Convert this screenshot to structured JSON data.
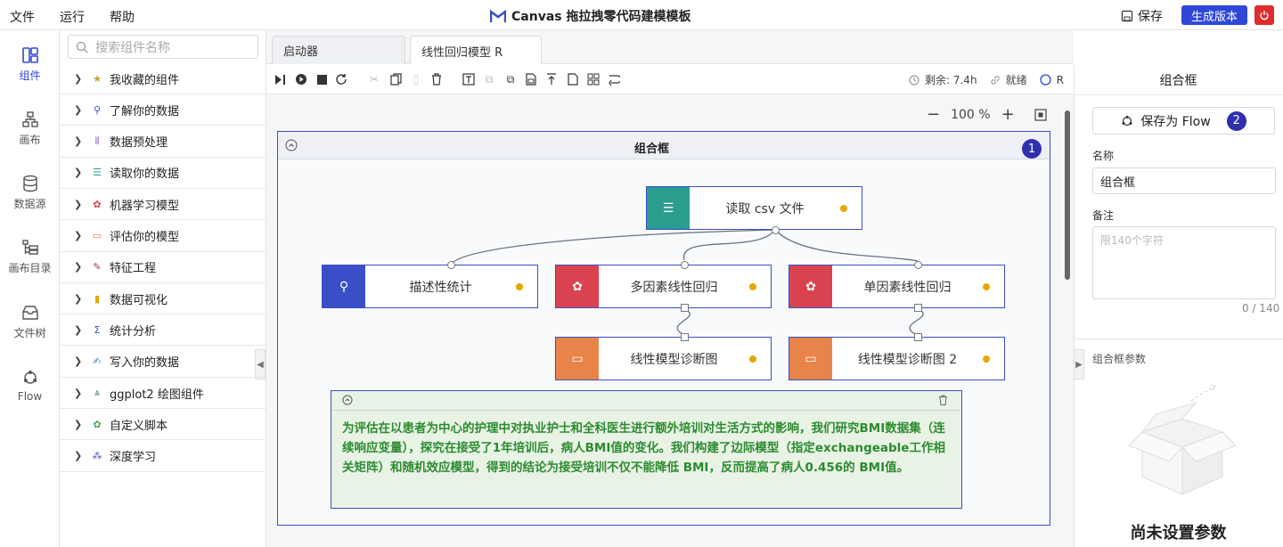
{
  "menu": {
    "file": "文件",
    "run": "运行",
    "help": "帮助"
  },
  "app": {
    "title": "Canvas 拖拉拽零代码建模模板",
    "save": "保存",
    "generate": "生成版本"
  },
  "rail": [
    {
      "label": "组件",
      "icon": "components-icon"
    },
    {
      "label": "画布",
      "icon": "canvas-icon"
    },
    {
      "label": "数据源",
      "icon": "database-icon"
    },
    {
      "label": "画布目录",
      "icon": "catalog-icon"
    },
    {
      "label": "文件树",
      "icon": "file-tree-icon"
    },
    {
      "label": "Flow",
      "icon": "flow-icon"
    }
  ],
  "search": {
    "placeholder": "搜索组件名称"
  },
  "categories": [
    {
      "label": "我收藏的组件",
      "icon": "star-icon",
      "color": "#c9a227"
    },
    {
      "label": "了解你的数据",
      "icon": "magnifier-icon",
      "color": "#3a4fc7"
    },
    {
      "label": "数据预处理",
      "icon": "preprocess-icon",
      "color": "#8a5cd6"
    },
    {
      "label": "读取你的数据",
      "icon": "read-data-icon",
      "color": "#2a9d8f"
    },
    {
      "label": "机器学习模型",
      "icon": "brain-icon",
      "color": "#d9434f"
    },
    {
      "label": "评估你的模型",
      "icon": "evaluate-icon",
      "color": "#e8834a"
    },
    {
      "label": "特征工程",
      "icon": "feature-icon",
      "color": "#b0344a"
    },
    {
      "label": "数据可视化",
      "icon": "bar-chart-icon",
      "color": "#e5a800"
    },
    {
      "label": "统计分析",
      "icon": "sigma-icon",
      "color": "#3a4fc7"
    },
    {
      "label": "写入你的数据",
      "icon": "write-data-icon",
      "color": "#3a7fc7"
    },
    {
      "label": "ggplot2 绘图组件",
      "icon": "ggplot-icon",
      "color": "#3a8f5a"
    },
    {
      "label": "自定义脚本",
      "icon": "script-icon",
      "color": "#4aa05a"
    },
    {
      "label": "深度学习",
      "icon": "deep-learning-icon",
      "color": "#3a4fc7"
    }
  ],
  "tabs": [
    {
      "label": "启动器"
    },
    {
      "label": "线性回归模型 R"
    }
  ],
  "status": {
    "remaining": "剩余: 7.4h",
    "ready": "就绪",
    "kernel": "R"
  },
  "zoom": {
    "level": "100 %",
    "minus": "−",
    "plus": "+"
  },
  "group": {
    "title": "组合框",
    "badge": "1"
  },
  "nodes": {
    "read_csv": "读取 csv 文件",
    "describe": "描述性统计",
    "multi_reg": "多因素线性回归",
    "single_reg": "单因素线性回归",
    "diag1": "线性模型诊断图",
    "diag2": "线性模型诊断图 2"
  },
  "note": {
    "text": "为评估在以患者为中心的护理中对执业护士和全科医生进行额外培训对生活方式的影响，我们研究BMI数据集（连续响应变量），探究在接受了1年培训后，病人BMI值的变化。我们构建了边际模型（指定exchangeable工作相关矩阵）和随机效应模型，得到的结论为接受培训不仅不能降低 BMI，反而提高了病人0.456的 BMI值。"
  },
  "right": {
    "title": "组合框",
    "save_flow": "保存为 Flow",
    "badge": "2",
    "name_label": "名称",
    "name_value": "组合框",
    "note_label": "备注",
    "note_placeholder": "限140个字符",
    "counter": "0 / 140",
    "params_label": "组合框参数",
    "empty": "尚未设置参数"
  }
}
